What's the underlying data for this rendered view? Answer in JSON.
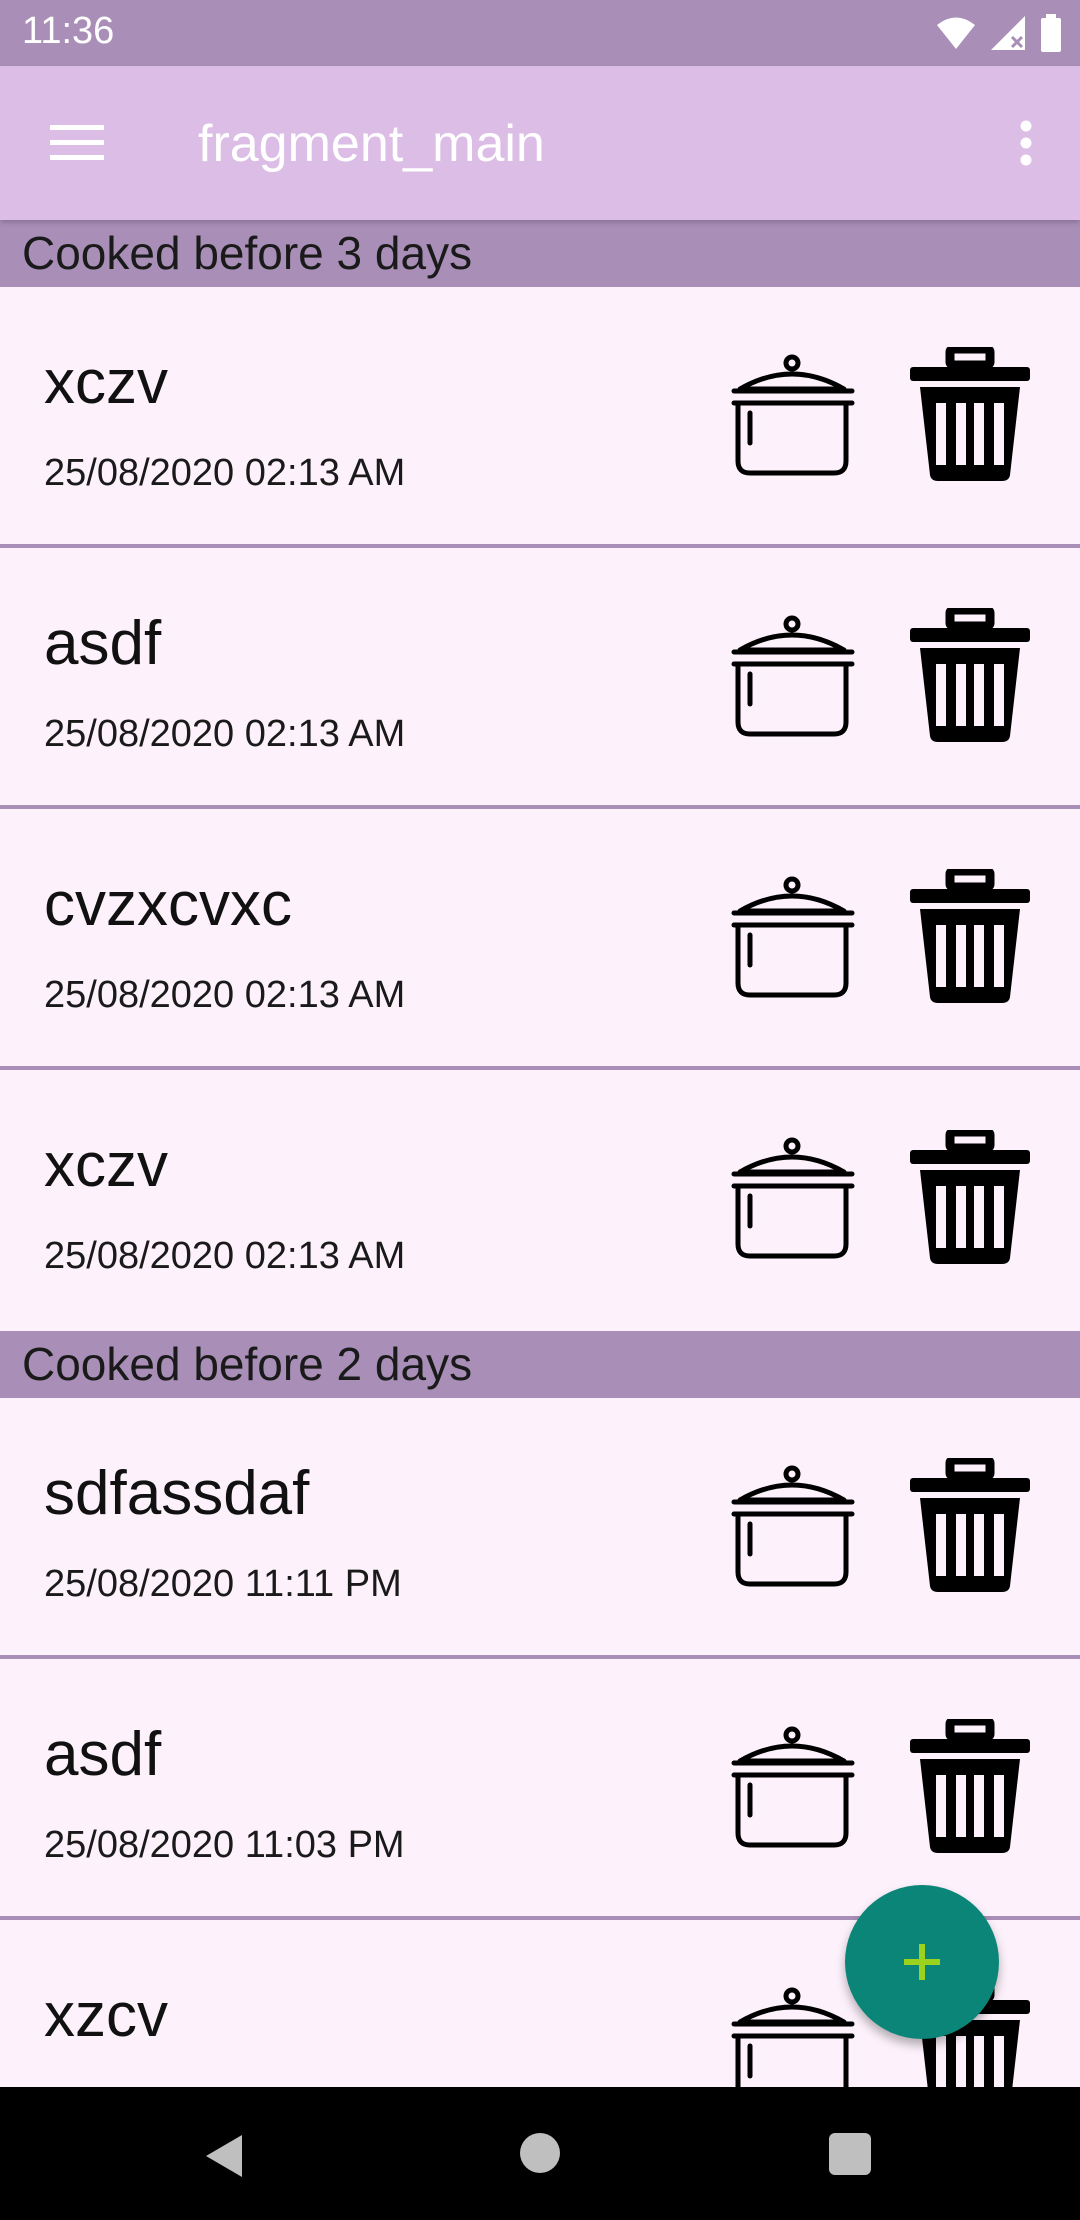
{
  "status_bar": {
    "time": "11:36"
  },
  "app_bar": {
    "title": "fragment_main"
  },
  "sections": [
    {
      "header": "Cooked before 3 days",
      "items": [
        {
          "title": "xczv",
          "date": "25/08/2020 02:13 AM"
        },
        {
          "title": "asdf",
          "date": "25/08/2020 02:13 AM"
        },
        {
          "title": "cvzxcvxc",
          "date": "25/08/2020 02:13 AM"
        },
        {
          "title": "xczv",
          "date": "25/08/2020 02:13 AM"
        }
      ]
    },
    {
      "header": "Cooked before 2 days",
      "items": [
        {
          "title": "sdfassdaf",
          "date": "25/08/2020 11:11 PM"
        },
        {
          "title": "asdf",
          "date": "25/08/2020 11:03 PM"
        },
        {
          "title": "xzcv",
          "date": ""
        }
      ]
    }
  ],
  "icons": {
    "menu": "hamburger-menu-icon",
    "overflow": "more-vertical-icon",
    "cook": "cooking-pot-icon",
    "delete": "trash-bin-icon",
    "fab": "plus-icon"
  },
  "colors": {
    "status_bar": "#a98fb8",
    "app_bar": "#dcbde6",
    "section_header": "#a98fb8",
    "list_background": "#fdf1fb",
    "fab": "#0b8577",
    "fab_icon": "#9bd21d"
  }
}
